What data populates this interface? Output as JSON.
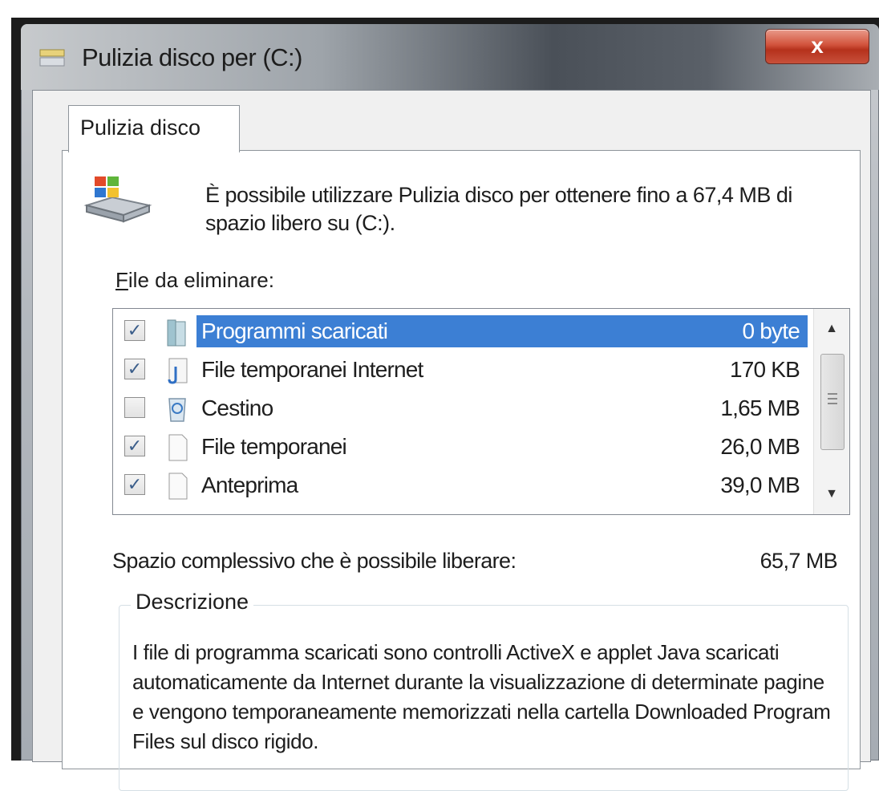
{
  "window": {
    "title": "Pulizia disco per  (C:)",
    "close_label": "x"
  },
  "tabs": [
    {
      "label": "Pulizia disco"
    }
  ],
  "intro": {
    "text": "È possibile utilizzare Pulizia disco per ottenere fino a 67,4 MB di spazio libero su  (C:)."
  },
  "files": {
    "label_accel": "F",
    "label_rest": "ile da eliminare:",
    "items": [
      {
        "name": "Programmi scaricati",
        "size": "0 byte",
        "checked": true,
        "selected": true,
        "icon": "folder-icon"
      },
      {
        "name": "File temporanei Internet",
        "size": "170 KB",
        "checked": true,
        "selected": false,
        "icon": "internet-files-icon"
      },
      {
        "name": "Cestino",
        "size": "1,65 MB",
        "checked": false,
        "selected": false,
        "icon": "recycle-bin-icon"
      },
      {
        "name": "File temporanei",
        "size": "26,0 MB",
        "checked": true,
        "selected": false,
        "icon": "file-icon"
      },
      {
        "name": "Anteprima",
        "size": "39,0 MB",
        "checked": true,
        "selected": false,
        "icon": "file-icon"
      }
    ]
  },
  "total": {
    "label": "Spazio complessivo che è possibile liberare:",
    "value": "65,7 MB"
  },
  "description": {
    "title": "Descrizione",
    "text": "I file di programma scaricati sono controlli ActiveX e applet Java scaricati automaticamente da Internet durante la visualizzazione di determinate pagine e vengono temporaneamente memorizzati nella cartella Downloaded Program Files sul disco rigido."
  },
  "colors": {
    "selection": "#3c7fd4",
    "close_button": "#c8513b"
  }
}
